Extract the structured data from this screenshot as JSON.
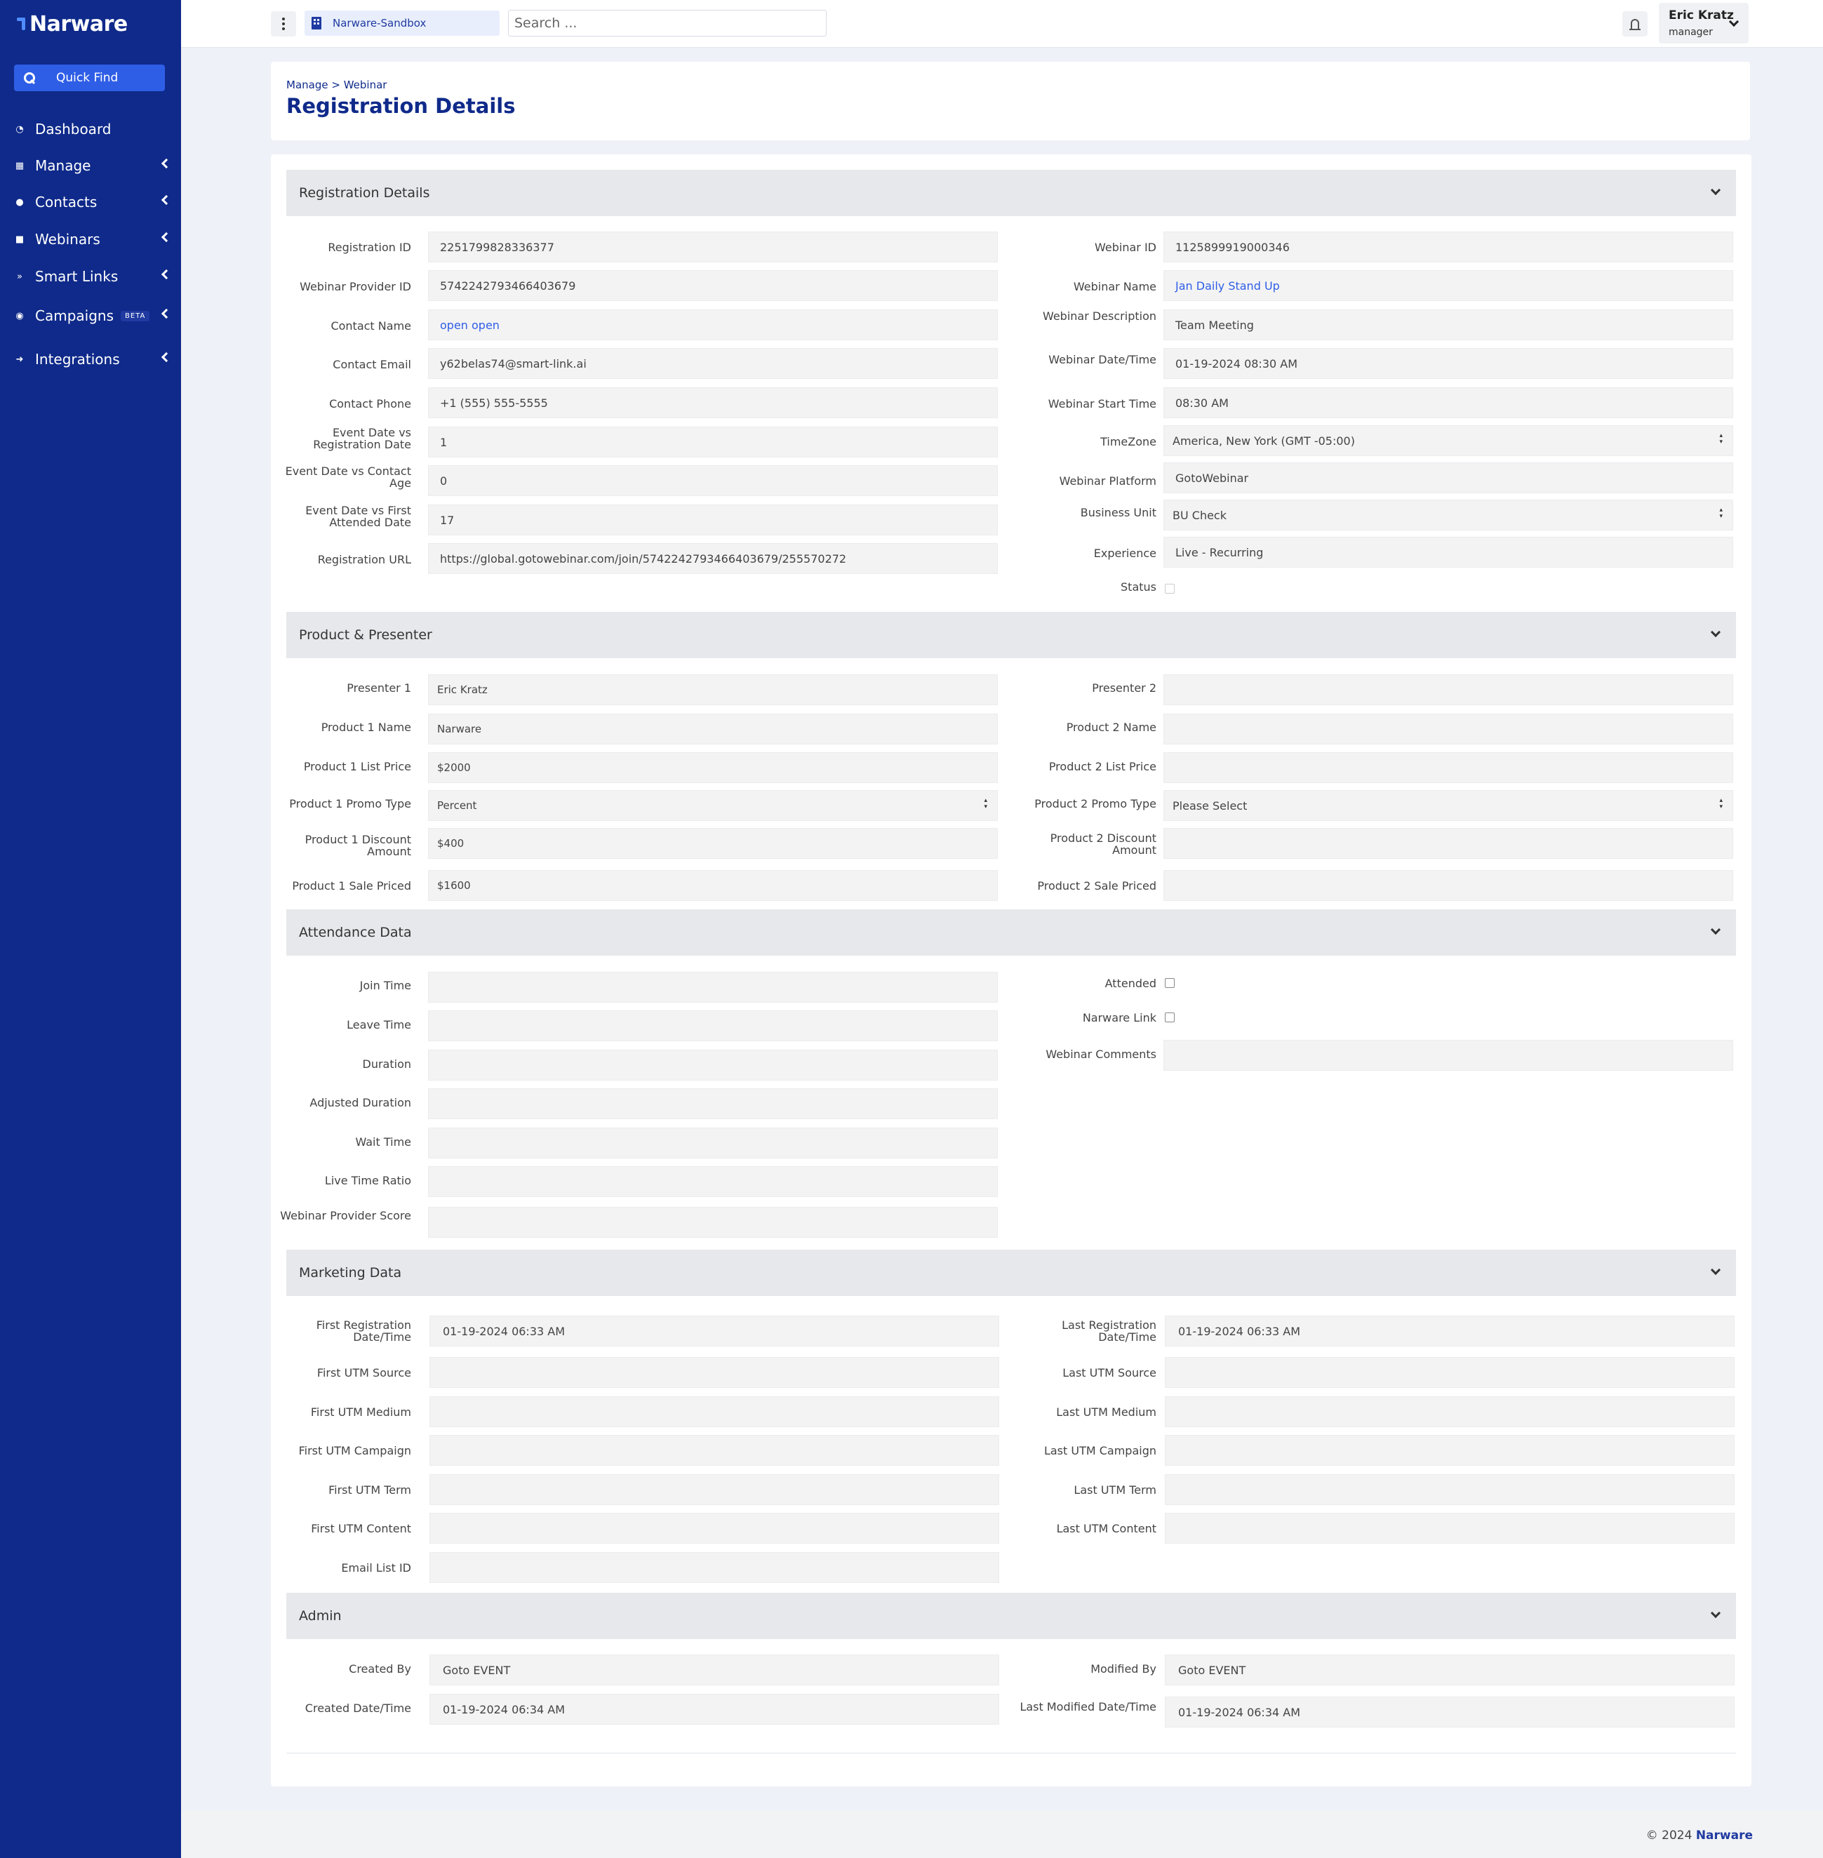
{
  "brand": {
    "name": "Narware"
  },
  "sidebar": {
    "quick_find": "Quick Find",
    "items": [
      {
        "label": "Dashboard",
        "icon": "dashboard-icon"
      },
      {
        "label": "Manage",
        "icon": "manage-icon"
      },
      {
        "label": "Contacts",
        "icon": "contacts-icon"
      },
      {
        "label": "Webinars",
        "icon": "video-icon"
      },
      {
        "label": "Smart Links",
        "icon": "double-chevron-icon"
      },
      {
        "label": "Campaigns",
        "icon": "campaigns-icon",
        "badge": "BETA"
      },
      {
        "label": "Integrations",
        "icon": "sign-in-icon"
      }
    ]
  },
  "topbar": {
    "org": "Narware-Sandbox",
    "search_placeholder": "Search ...",
    "user_name": "Eric Kratz",
    "user_role": "manager"
  },
  "header": {
    "breadcrumb": {
      "parent": "Manage",
      "sep": " > ",
      "current": "Webinar"
    },
    "title": "Registration Details"
  },
  "sections": {
    "registration": {
      "title": "Registration Details",
      "left": [
        {
          "label": "Registration ID",
          "value": "2251799828336377"
        },
        {
          "label": "Webinar Provider ID",
          "value": "5742242793466403679"
        },
        {
          "label": "Contact Name",
          "value": "open open"
        },
        {
          "label": "Contact Email",
          "value": "y62belas74@smart-link.ai"
        },
        {
          "label": "Contact Phone",
          "value": "+1 (555) 555-5555"
        },
        {
          "label": "Event Date vs Registration Date",
          "value": "1"
        },
        {
          "label": "Event Date vs Contact Age",
          "value": "0"
        },
        {
          "label": "Event Date vs First Attended Date",
          "value": "17"
        },
        {
          "label": "Registration URL",
          "value": "https://global.gotowebinar.com/join/5742242793466403679/255570272"
        }
      ],
      "right": [
        {
          "label": "Webinar ID",
          "value": "1125899919000346"
        },
        {
          "label": "Webinar Name",
          "value": "Jan Daily Stand Up"
        },
        {
          "label": "Webinar Description",
          "value": "Team Meeting"
        },
        {
          "label": "Webinar Date/Time",
          "value": "01-19-2024 08:30 AM"
        },
        {
          "label": "Webinar Start Time",
          "value": "08:30 AM"
        },
        {
          "label": "TimeZone",
          "value": "America, New York (GMT -05:00)"
        },
        {
          "label": "Webinar Platform",
          "value": "GotoWebinar"
        },
        {
          "label": "Business Unit",
          "value": "BU Check"
        },
        {
          "label": "Experience",
          "value": "Live - Recurring"
        },
        {
          "label": "Status",
          "value": ""
        }
      ]
    },
    "product": {
      "title": "Product & Presenter",
      "left": [
        {
          "label": "Presenter 1",
          "value": "Eric Kratz"
        },
        {
          "label": "Product 1 Name",
          "value": "Narware"
        },
        {
          "label": "Product 1 List Price",
          "value": "$2000"
        },
        {
          "label": "Product 1 Promo Type",
          "value": "Percent"
        },
        {
          "label": "Product 1 Discount Amount",
          "value": "$400"
        },
        {
          "label": "Product 1 Sale Priced",
          "value": "$1600"
        }
      ],
      "right": [
        {
          "label": "Presenter 2",
          "value": ""
        },
        {
          "label": "Product 2 Name",
          "value": ""
        },
        {
          "label": "Product 2 List Price",
          "value": ""
        },
        {
          "label": "Product 2 Promo Type",
          "value": "Please Select"
        },
        {
          "label": "Product 2 Discount Amount",
          "value": ""
        },
        {
          "label": "Product 2 Sale Priced",
          "value": ""
        }
      ]
    },
    "attendance": {
      "title": "Attendance Data",
      "left": [
        {
          "label": "Join Time",
          "value": ""
        },
        {
          "label": "Leave Time",
          "value": ""
        },
        {
          "label": "Duration",
          "value": ""
        },
        {
          "label": "Adjusted Duration",
          "value": ""
        },
        {
          "label": "Wait Time",
          "value": ""
        },
        {
          "label": "Live Time Ratio",
          "value": ""
        },
        {
          "label": "Webinar Provider Score",
          "value": ""
        }
      ],
      "right": [
        {
          "label": "Attended",
          "value": ""
        },
        {
          "label": "Narware Link",
          "value": ""
        },
        {
          "label": "Webinar Comments",
          "value": ""
        }
      ]
    },
    "marketing": {
      "title": "Marketing Data",
      "left": [
        {
          "label": "First Registration Date/Time",
          "value": "01-19-2024 06:33 AM"
        },
        {
          "label": "First UTM Source",
          "value": ""
        },
        {
          "label": "First UTM Medium",
          "value": ""
        },
        {
          "label": "First UTM Campaign",
          "value": ""
        },
        {
          "label": "First UTM Term",
          "value": ""
        },
        {
          "label": "First UTM Content",
          "value": ""
        },
        {
          "label": "Email List ID",
          "value": ""
        }
      ],
      "right": [
        {
          "label": "Last Registration Date/Time",
          "value": "01-19-2024 06:33 AM"
        },
        {
          "label": "Last UTM Source",
          "value": ""
        },
        {
          "label": "Last UTM Medium",
          "value": ""
        },
        {
          "label": "Last UTM Campaign",
          "value": ""
        },
        {
          "label": "Last UTM Term",
          "value": ""
        },
        {
          "label": "Last UTM Content",
          "value": ""
        }
      ]
    },
    "admin": {
      "title": "Admin",
      "left": [
        {
          "label": "Created By",
          "value": "Goto EVENT"
        },
        {
          "label": "Created Date/Time",
          "value": "01-19-2024 06:34 AM"
        }
      ],
      "right": [
        {
          "label": "Modified By",
          "value": "Goto EVENT"
        },
        {
          "label": "Last Modified Date/Time",
          "value": "01-19-2024 06:34 AM"
        }
      ]
    }
  },
  "footer": {
    "copyright": "© 2024",
    "brand": "Narware"
  }
}
